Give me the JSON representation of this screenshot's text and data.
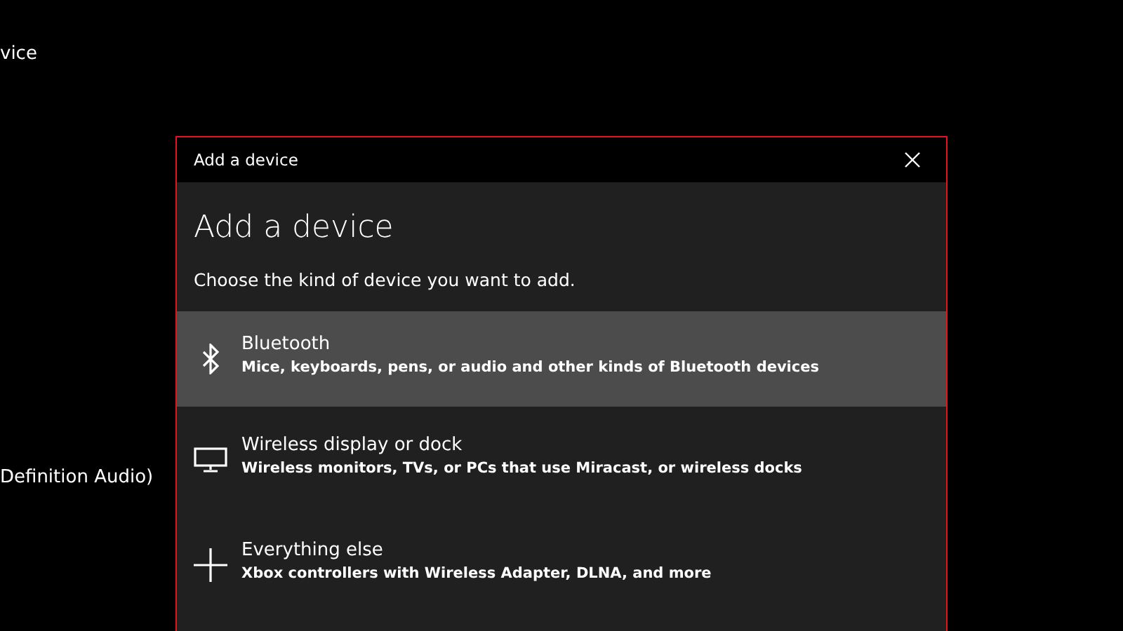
{
  "background_texts": [
    "vice",
    "Definition Audio)"
  ],
  "dialog": {
    "title": "Add a device",
    "heading": "Add a device",
    "instruction": "Choose the kind of device you want to add.",
    "options": [
      {
        "kind": "bluetooth",
        "title": "Bluetooth",
        "description": "Mice, keyboards, pens, or audio and other kinds of Bluetooth devices",
        "selected": true
      },
      {
        "kind": "display",
        "title": "Wireless display or dock",
        "description": "Wireless monitors, TVs, or PCs that use Miracast, or wireless docks",
        "selected": false
      },
      {
        "kind": "other",
        "title": "Everything else",
        "description": "Xbox controllers with Wireless Adapter, DLNA, and more",
        "selected": false
      }
    ]
  }
}
